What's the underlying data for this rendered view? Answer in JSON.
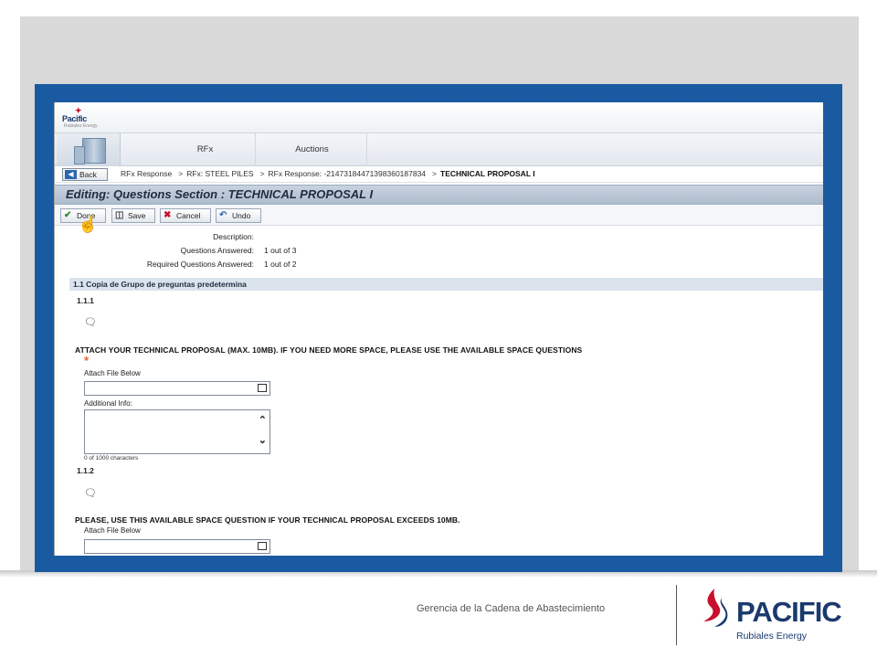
{
  "app": {
    "logo_word": "Pacific",
    "logo_sub": "Rubiales Energy"
  },
  "nav": {
    "tabs": [
      {
        "label": "RFx"
      },
      {
        "label": "Auctions"
      }
    ]
  },
  "breadcrumb": {
    "back_label": "Back",
    "items": [
      "RFx Response",
      "RFx: STEEL PILES",
      "RFx Response: -2147318447139836018783​4"
    ],
    "current": "TECHNICAL PROPOSAL I"
  },
  "page": {
    "title": "Editing: Questions Section : TECHNICAL PROPOSAL I"
  },
  "toolbar": {
    "done_label": "Done",
    "save_label": "Save",
    "cancel_label": "Cancel",
    "undo_label": "Undo"
  },
  "summary": {
    "description_label": "Description:",
    "description_value": "",
    "answered_label": "Questions Answered:",
    "answered_value": "1 out of 3",
    "required_label": "Required Questions Answered:",
    "required_value": "1 out of 2"
  },
  "section": {
    "title": "1.1 Copia de Grupo de preguntas predetermina",
    "questions": [
      {
        "number": "1.1.1",
        "text": "ATTACH YOUR TECHNICAL PROPOSAL (MAX. 10MB). IF YOU NEED MORE SPACE, PLEASE USE THE AVAILABLE SPACE QUESTIONS",
        "required_mark": "*",
        "attach_label": "Attach File Below",
        "additional_label": "Additional Info:",
        "char_count": "0 of 1000 characters"
      },
      {
        "number": "1.1.2",
        "text": "PLEASE, USE THIS AVAILABLE SPACE QUESTION IF YOUR TECHNICAL PROPOSAL EXCEEDS 10MB.",
        "attach_label": "Attach File Below"
      }
    ]
  },
  "footer": {
    "caption": "Gerencia de la Cadena de Abastecimiento",
    "logo_word": "PACIFIC",
    "logo_sub": "Rubiales Energy",
    "brand_colors": {
      "navy": "#1a3a6e",
      "red": "#c8102e",
      "frame_blue": "#1a5aa0"
    }
  }
}
